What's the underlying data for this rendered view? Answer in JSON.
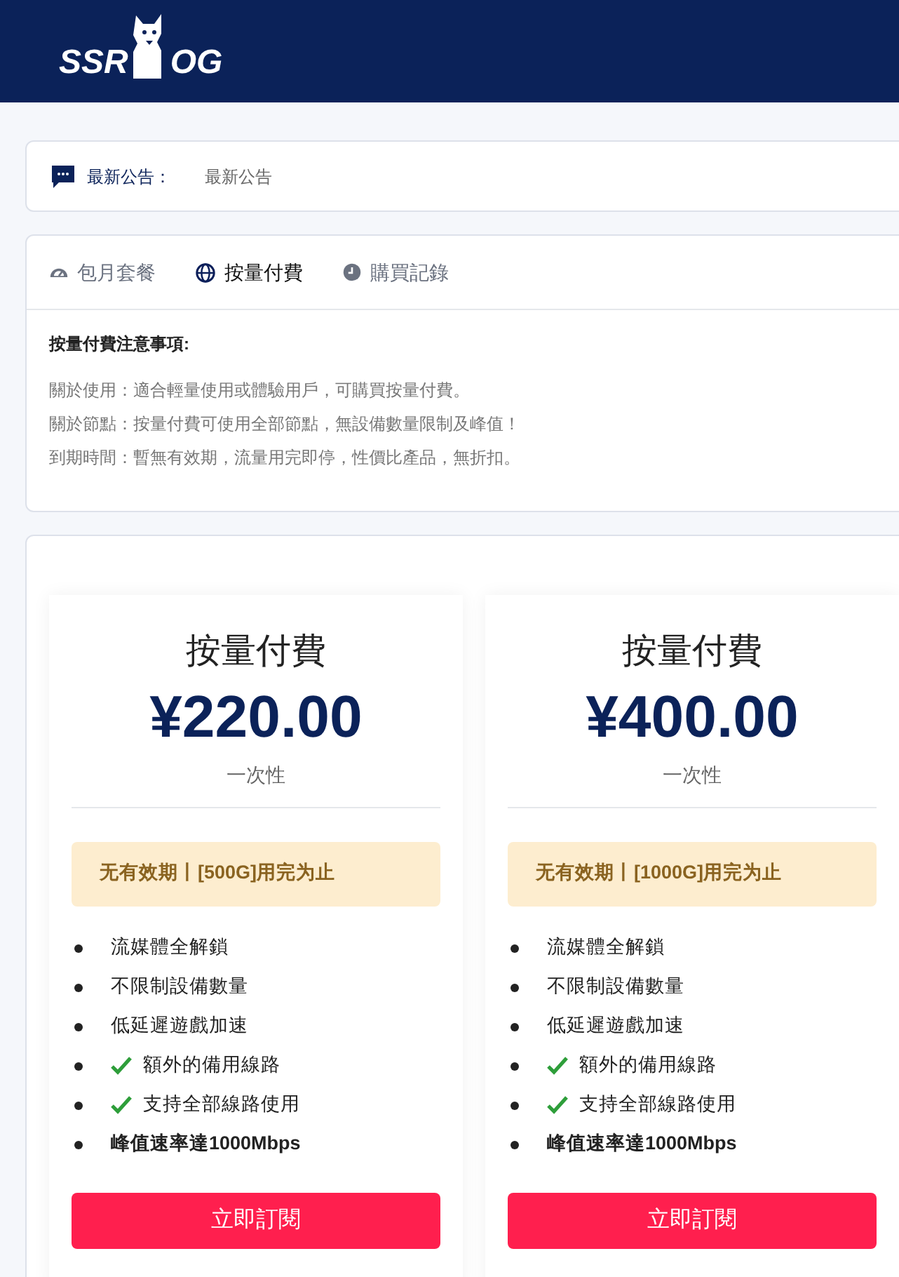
{
  "logo": {
    "before": "SSR",
    "after": "OG"
  },
  "notice": {
    "label": "最新公告：",
    "text": "最新公告"
  },
  "tabs": [
    {
      "label": "包月套餐",
      "selected": false,
      "kind": "gauge"
    },
    {
      "label": "按量付費",
      "selected": true,
      "kind": "globe"
    },
    {
      "label": "購買記錄",
      "selected": false,
      "kind": "clock"
    }
  ],
  "notes": {
    "title": "按量付費注意事項:",
    "lines": [
      "關於使用：適合輕量使用或體驗用戶，可購買按量付費。",
      "關於節點：按量付費可使用全部節點，無設備數量限制及峰值！",
      "到期時間：暫無有效期，流量用完即停，性價比產品，無折扣。"
    ]
  },
  "plans": [
    {
      "name": "按量付費",
      "price": "¥220.00",
      "period": "一次性",
      "banner": "无有效期丨[500G]用完为止",
      "features": [
        {
          "text": "流媒體全解鎖",
          "kind": "plain"
        },
        {
          "text": "不限制設備數量",
          "kind": "plain"
        },
        {
          "text": "低延遲遊戲加速",
          "kind": "plain"
        },
        {
          "text": "額外的備用線路",
          "kind": "check"
        },
        {
          "text": "支持全部線路使用",
          "kind": "check"
        },
        {
          "text": "峰值速率達1000Mbps",
          "kind": "bold"
        }
      ],
      "button": "立即訂閱"
    },
    {
      "name": "按量付費",
      "price": "¥400.00",
      "period": "一次性",
      "banner": "无有效期丨[1000G]用完为止",
      "features": [
        {
          "text": "流媒體全解鎖",
          "kind": "plain"
        },
        {
          "text": "不限制設備數量",
          "kind": "plain"
        },
        {
          "text": "低延遲遊戲加速",
          "kind": "plain"
        },
        {
          "text": "額外的備用線路",
          "kind": "check"
        },
        {
          "text": "支持全部線路使用",
          "kind": "check"
        },
        {
          "text": "峰值速率達1000Mbps",
          "kind": "bold"
        }
      ],
      "button": "立即訂閱"
    }
  ]
}
